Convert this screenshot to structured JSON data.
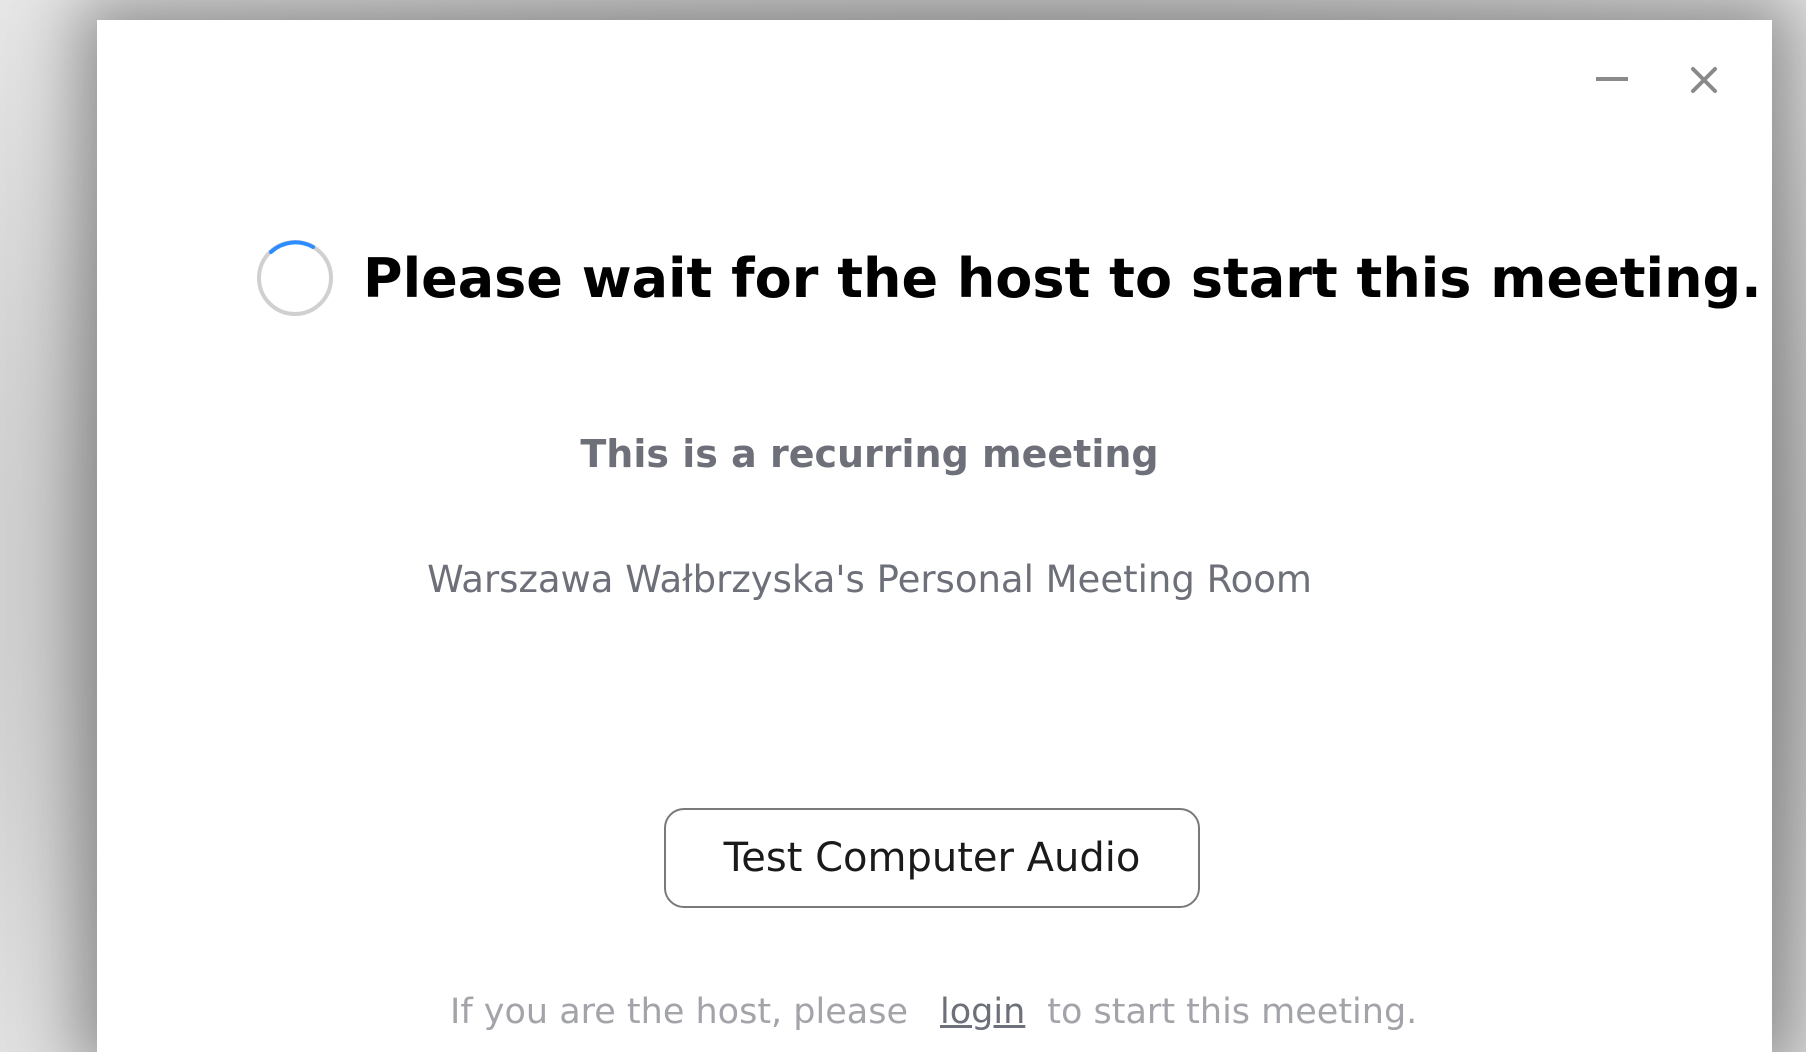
{
  "window": {
    "controls": {
      "minimize_icon": "minimize-icon",
      "close_icon": "close-icon"
    }
  },
  "status": {
    "spinner_icon": "loading-spinner-icon",
    "headline": "Please wait for the host to start this meeting."
  },
  "meeting": {
    "recurring_label": "This is a recurring meeting",
    "room_name": "Warszawa Wałbrzyska's Personal Meeting Room"
  },
  "actions": {
    "test_audio_label": "Test Computer Audio"
  },
  "footer": {
    "prefix": "If you are the host, please",
    "login_link": "login",
    "suffix": "to start this meeting."
  },
  "colors": {
    "spinner_accent": "#2d8cff",
    "spinner_track": "#d0d0d0",
    "muted_text": "#6e7079",
    "footer_text": "#a3a4aa"
  }
}
